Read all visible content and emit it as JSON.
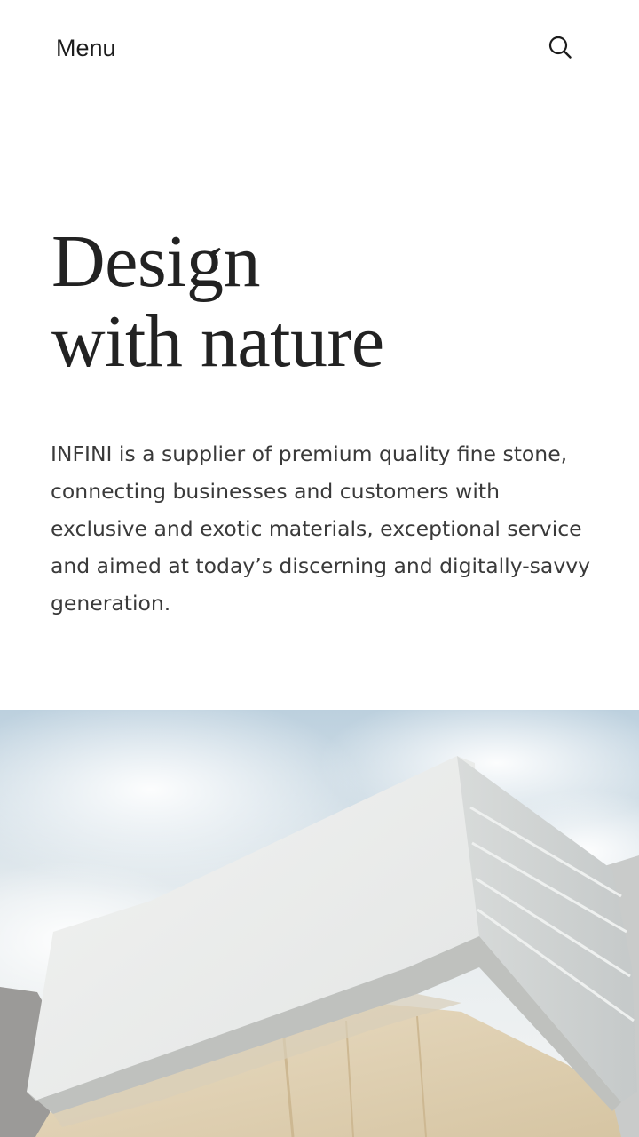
{
  "header": {
    "menu_label": "Menu",
    "search_icon": "search-icon"
  },
  "hero": {
    "title_line_1": "Design",
    "title_line_2": "with nature",
    "intro": "INFINI is a supplier of premium quality fine stone, connecting businesses and customers with exclusive and exotic materials, exceptional service and aimed at today’s discerning and digitally-savvy generation."
  },
  "image": {
    "subject": "stacked-stone-blocks-photo"
  },
  "colors": {
    "text": "#222222",
    "body_text": "#3a3a3a",
    "background": "#ffffff"
  }
}
